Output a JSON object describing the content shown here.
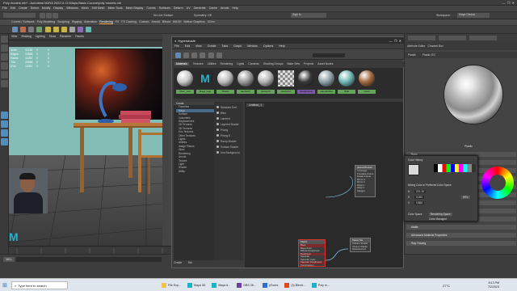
{
  "window": {
    "title": "Poly models.mb* - Autodesk MAYA 2022.3: D:\\Maya Basic Course\\poly models.mb"
  },
  "menubar": [
    "File",
    "Edit",
    "Create",
    "Select",
    "Modify",
    "Display",
    "Windows",
    "Mesh",
    "Edit Mesh",
    "Mesh Tools",
    "Mesh Display",
    "Curves",
    "Surfaces",
    "Deform",
    "UV",
    "Generate",
    "Cache",
    "Arnold",
    "Help"
  ],
  "toolbar": {
    "workspace_label": "Workspace:",
    "workspace_value": "Maya Classic",
    "no_live": "No Live Surface",
    "symmetry": "Symmetry: Off",
    "signin": "Sign In"
  },
  "shelf_tabs": [
    "Curves / Surfaces",
    "Poly Modeling",
    "Sculpting",
    "Rigging",
    "Animation",
    "Rendering",
    "FX",
    "FX Caching",
    "Custom",
    "Arnold",
    "Bifrost",
    "MASH",
    "Motion Graphics",
    "XGen"
  ],
  "shelf_active": "Rendering",
  "viewport": {
    "menu": [
      "View",
      "Shading",
      "Lighting",
      "Show",
      "Renderer",
      "Panels"
    ],
    "hud": [
      {
        "label": "Verts:",
        "a": "11318",
        "b": "0",
        "c": "0"
      },
      {
        "label": "Edges:",
        "a": "22568",
        "b": "0",
        "c": "0"
      },
      {
        "label": "Faces:",
        "a": "11283",
        "b": "0",
        "c": "0"
      },
      {
        "label": "Tris:",
        "a": "22558",
        "b": "0",
        "c": "0"
      },
      {
        "label": "UVs:",
        "a": "11952",
        "b": "0",
        "c": "0"
      }
    ]
  },
  "hypershade": {
    "title": "Hypershade",
    "menu": [
      "File",
      "Edit",
      "View",
      "Create",
      "Tabs",
      "Graph",
      "Window",
      "Options",
      "Help"
    ],
    "browser_tabs": [
      "Materials",
      "Textures",
      "Utilities",
      "Rendering",
      "Lights",
      "Cameras",
      "Shading Groups",
      "Bake Sets",
      "Projects",
      "Asset Nodes"
    ],
    "active_tab": "Materials",
    "swatches": [
      {
        "label": "Floor_mat",
        "color": "#c9c9c9"
      },
      {
        "label": "Maya_logo",
        "color": "#2a2a2a"
      },
      {
        "label": "Plastic",
        "color": "#bdbdbd"
      },
      {
        "label": "lambert1",
        "color": "#9a9a9a"
      },
      {
        "label": "lambert2",
        "color": "#b5b5b5"
      },
      {
        "label": "particleCl",
        "color": "#7a7a7a"
      },
      {
        "label": "shaderGlow",
        "color": "#3a3a3a"
      },
      {
        "label": "standardSu",
        "color": "#8ea0a8"
      },
      {
        "label": "Wall",
        "color": "#6fb7b4"
      },
      {
        "label": "wood",
        "color": "#a06a3e"
      }
    ],
    "create_panel_header": "Create",
    "create_tree": [
      "Favorites",
      "Maya",
      "Surface",
      "Volumetric",
      "Displacement",
      "2D Textures",
      "3D Textures",
      "Env Textures",
      "Other Textures",
      "Lights",
      "Utilities",
      "Image Planes",
      "Glow",
      "Rendering",
      "Arnold",
      "Texture",
      "Light",
      "Shader",
      "Utility"
    ],
    "create_list": [
      "Standard Surf.",
      "Blinn",
      "Lambert",
      "Layered Shader",
      "Phong",
      "Phong E",
      "Ramp Shader",
      "Surface Shader",
      "Use Background"
    ],
    "graph_tab": "Untitled_1",
    "bottom_tabs": [
      "Create",
      "Bin"
    ],
    "nodes": [
      {
        "id": "n1",
        "title": "Plastic",
        "rows": [
          "Base",
          "Base Color",
          "Diffuse Roughness",
          "Metalness",
          "Specular",
          "Specular Color",
          "Specular Roughness",
          "Transmission",
          "Subsurface",
          "Coat",
          "Sheen",
          "Emission",
          "Thin Film",
          "Geometry"
        ],
        "sel": true
      },
      {
        "id": "n2",
        "title": "place2dTexture",
        "rows": [
          "Coverage",
          "Translate Frame",
          "Rotate Frame",
          "Mirror U",
          "Mirror V",
          "Wrap U",
          "Wrap V",
          "Stagger"
        ],
        "sel": false
      },
      {
        "id": "n3",
        "title": "Plastic SG",
        "rows": [
          "Surface Shader",
          "Volume Shader",
          "Displacement"
        ],
        "sel": false
      }
    ]
  },
  "attribute_editor": {
    "tabs": [
      "Attribute Editor",
      "Channel Box"
    ],
    "subtabs": [
      "Plastic",
      "Plastic SG"
    ],
    "sections": [
      "Base",
      "Specular",
      "Transmission",
      "Subsurface",
      "Coat",
      "Sheen",
      "Thin Film",
      "Emission",
      "Geometry",
      "Matte",
      "Advanced Material Properties",
      "Ray Tracing"
    ],
    "sample_label": "Plastic"
  },
  "color_picker": {
    "title": "Color History",
    "mixing_space": "Mixing Color in Preferred Color Space",
    "h_label": "H",
    "h_value": "221.15",
    "s_label": "S",
    "s_value": "0.000",
    "v_label": "V",
    "v_value": "0.866",
    "hsv": "HSV",
    "color_space_label": "Color Space",
    "color_space_value": "Rendering Space",
    "color_managed": "Color Managed"
  },
  "taskbar": {
    "search": "Type here to search",
    "apps": [
      "File Exp...",
      "Maya 3D",
      "Maya 8...",
      "OBS 28...",
      "pToons",
      "(3) Blend...",
      "Poly m..."
    ],
    "weather": "27°C",
    "time": "8:13 PM",
    "date": "7/2/2023"
  },
  "colors": {
    "accent": "#f29e3c",
    "selection": "#e03030",
    "swatch_label_bg": "#66a35a",
    "wall": "#83bdb6"
  }
}
